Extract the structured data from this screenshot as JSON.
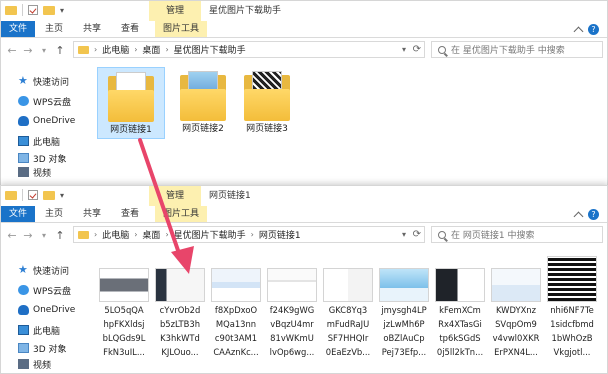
{
  "window1": {
    "title": "星优图片下载助手",
    "context_tab": "管理",
    "tabs": [
      "文件",
      "主页",
      "共享",
      "查看",
      "图片工具"
    ],
    "path": [
      "此电脑",
      "桌面",
      "星优图片下载助手"
    ],
    "search_placeholder": "在 星优图片下载助手 中搜索",
    "folders": [
      {
        "label": "网页链接1",
        "selected": true
      },
      {
        "label": "网页链接2",
        "selected": false
      },
      {
        "label": "网页链接3",
        "selected": false
      }
    ]
  },
  "window2": {
    "title": "网页链接1",
    "context_tab": "管理",
    "tabs": [
      "文件",
      "主页",
      "共享",
      "查看",
      "图片工具"
    ],
    "path": [
      "此电脑",
      "桌面",
      "星优图片下载助手",
      "网页链接1"
    ],
    "search_placeholder": "在 网页链接1 中搜索",
    "images": [
      {
        "lines": [
          "5LO5qQA",
          "hpFKXldsj",
          "bLQGds9L",
          "FkN3uIL..."
        ],
        "thumb": "gray"
      },
      {
        "lines": [
          "cYvrOb2d",
          "b5zLTB3h",
          "K3hkWTd",
          "KJLOuo..."
        ],
        "thumb": "dark"
      },
      {
        "lines": [
          "f8XpDxoO",
          "MQa13nn",
          "c90t3AM1",
          "CAAznKc..."
        ],
        "thumb": "blue"
      },
      {
        "lines": [
          "f24K9gWG",
          "vBqzU4mr",
          "81vWKmU",
          "lvOp6wg..."
        ],
        "thumb": "white"
      },
      {
        "lines": [
          "GKC8Yq3",
          "mFudRaJU",
          "SF7HHQIr",
          "0EaEzVb..."
        ],
        "thumb": "red"
      },
      {
        "lines": [
          "jmysgh4LP",
          "jzLwMh6P",
          "oBZlAuCp",
          "Pej73Efp..."
        ],
        "thumb": "sky"
      },
      {
        "lines": [
          "kFemXCm",
          "Rx4XTasGi",
          "tp6kSGdS",
          "0j5ll2kTn..."
        ],
        "thumb": "dark2"
      },
      {
        "lines": [
          "KWDYXnz",
          "SVqpOm9",
          "v4vwl0XKR",
          "ErPXN4L..."
        ],
        "thumb": "light"
      },
      {
        "lines": [
          "nhi6NF7Te",
          "1sidcfbmd",
          "1bWhOzB",
          "Vkgjotl..."
        ],
        "thumb": "qr"
      }
    ]
  },
  "sidebar": {
    "items": [
      {
        "label": "快速访问",
        "icon": "star-icon"
      },
      {
        "label": "WPS云盘",
        "icon": "cloud-icon"
      },
      {
        "label": "OneDrive",
        "icon": "onedrive-icon"
      },
      {
        "label": "此电脑",
        "icon": "computer-icon"
      },
      {
        "label": "3D 对象",
        "icon": "3d-objects-icon"
      },
      {
        "label": "视频",
        "icon": "video-icon"
      }
    ]
  },
  "colors": {
    "file_tab": "#1a73c9",
    "context_tab": "#fdf0b0",
    "selection": "#cce8ff",
    "arrow": "#e8456a"
  }
}
